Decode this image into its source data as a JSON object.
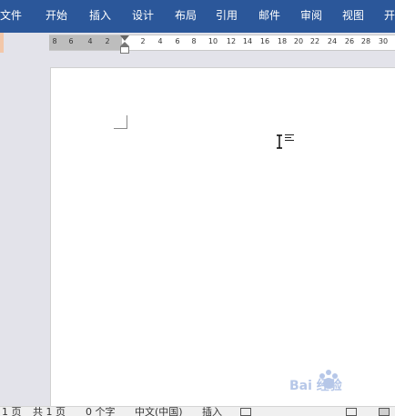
{
  "ribbon": {
    "tabs": [
      {
        "label": "文件"
      },
      {
        "label": "开始"
      },
      {
        "label": "插入"
      },
      {
        "label": "设计"
      },
      {
        "label": "布局"
      },
      {
        "label": "引用"
      },
      {
        "label": "邮件"
      },
      {
        "label": "审阅"
      },
      {
        "label": "视图"
      },
      {
        "label": "开"
      }
    ],
    "color": "#2b579a"
  },
  "ruler": {
    "margin_labels": [
      "8",
      "6",
      "4",
      "2"
    ],
    "labels": [
      "2",
      "4",
      "6",
      "8",
      "10",
      "12",
      "14",
      "16",
      "18",
      "20",
      "22",
      "24",
      "26",
      "28",
      "30"
    ]
  },
  "statusbar": {
    "page": "1 页",
    "total": "共 1 页",
    "words": "0 个字",
    "language": "中文(中国)",
    "mode": "插入"
  },
  "watermark": {
    "text": "Bai 经验"
  }
}
